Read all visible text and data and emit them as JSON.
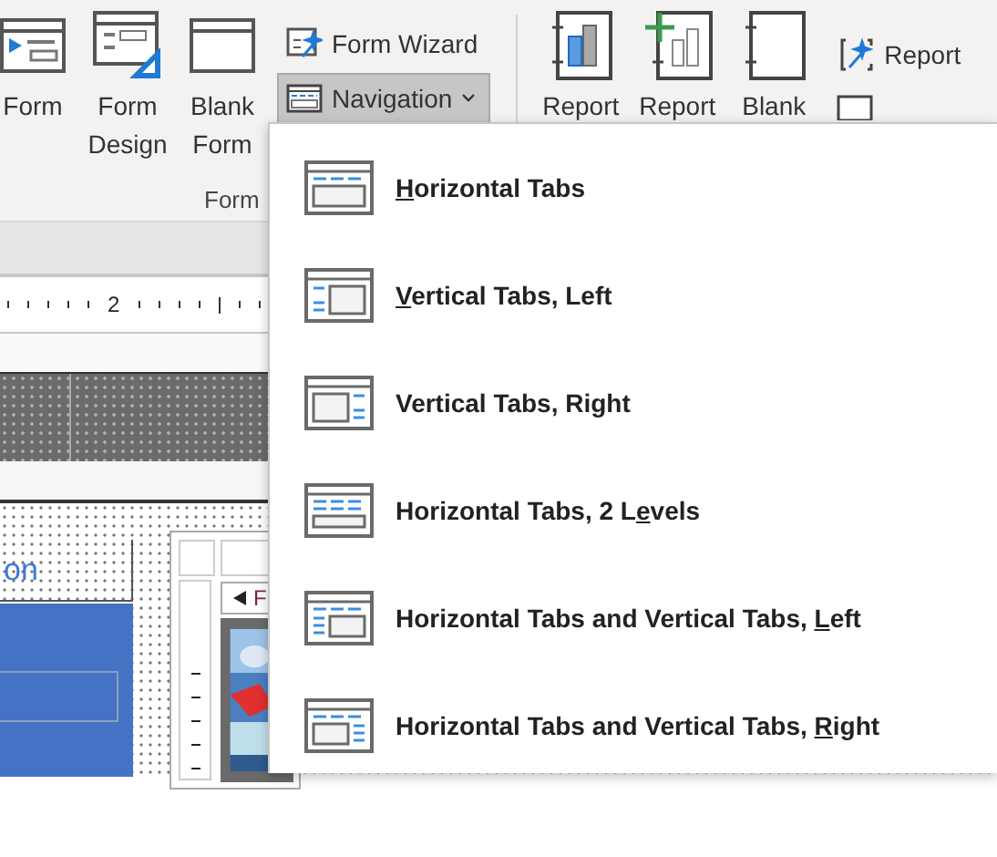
{
  "ribbon": {
    "forms_group": {
      "large_buttons": [
        {
          "label": "Form",
          "kind": "form"
        },
        {
          "label": "Form Design",
          "kind": "form_design"
        },
        {
          "label": "Blank Form",
          "kind": "blank_form"
        }
      ],
      "small_buttons": [
        {
          "label": "Form Wizard",
          "kind": "wizard",
          "selected": false
        },
        {
          "label": "Navigation",
          "kind": "navigation",
          "selected": true
        }
      ],
      "label": "Form"
    },
    "reports_group": {
      "large_buttons": [
        {
          "label": "Report",
          "kind": "report"
        },
        {
          "label": "Report",
          "kind": "report_design"
        },
        {
          "label": "Blank",
          "kind": "blank_report"
        }
      ],
      "small_buttons": [
        {
          "label": "Report",
          "kind": "wizard"
        }
      ]
    }
  },
  "design_view": {
    "ruler_mark": "2",
    "caption_fragment": "on",
    "subform_tab": "F"
  },
  "navigation_menu": {
    "items": [
      {
        "kind": "horizontal",
        "access_key": "H",
        "text_after": "orizontal Tabs"
      },
      {
        "kind": "vertical_left",
        "access_key": "V",
        "text_after": "ertical Tabs, Left"
      },
      {
        "kind": "vertical_right",
        "text_before": "Vertical Tabs, Right"
      },
      {
        "kind": "two_levels",
        "text_before": "Horizontal Tabs, 2 L",
        "access_key": "e",
        "text_after": "vels"
      },
      {
        "kind": "horizontal_vertical_left",
        "text_before": "Horizontal Tabs and Vertical Tabs, ",
        "access_key": "L",
        "text_after": "eft"
      },
      {
        "kind": "horizontal_vertical_right",
        "text_before": "Horizontal Tabs and Vertical Tabs, ",
        "access_key": "R",
        "text_after": "ight"
      }
    ]
  }
}
